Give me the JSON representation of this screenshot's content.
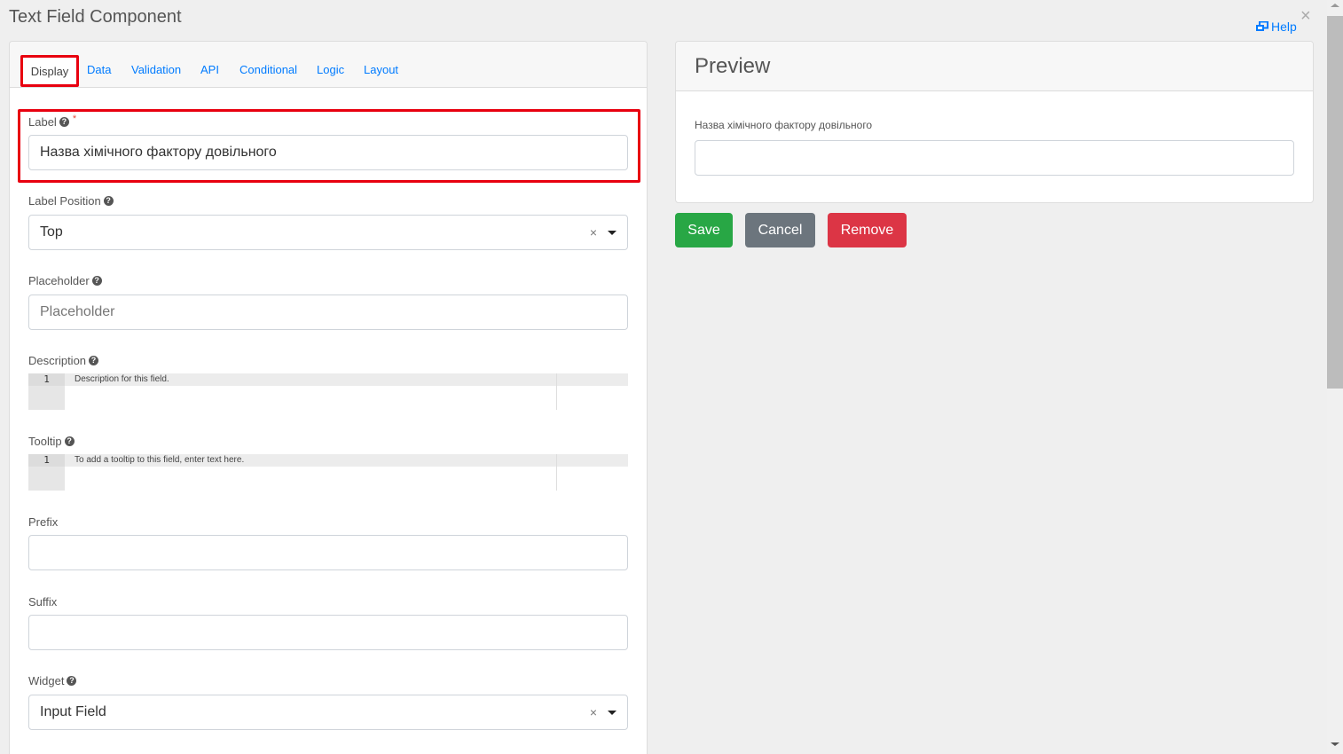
{
  "dialog": {
    "title": "Text Field Component",
    "help_label": "Help",
    "close_symbol": "×"
  },
  "tabs": [
    {
      "label": "Display",
      "active": true
    },
    {
      "label": "Data",
      "active": false
    },
    {
      "label": "Validation",
      "active": false
    },
    {
      "label": "API",
      "active": false
    },
    {
      "label": "Conditional",
      "active": false
    },
    {
      "label": "Logic",
      "active": false
    },
    {
      "label": "Layout",
      "active": false
    }
  ],
  "form": {
    "label": {
      "label": "Label",
      "required_mark": "*",
      "value": "Назва хімічного фактору довільного"
    },
    "label_position": {
      "label": "Label Position",
      "value": "Top",
      "clear_symbol": "×"
    },
    "placeholder": {
      "label": "Placeholder",
      "value": "",
      "placeholder": "Placeholder"
    },
    "description": {
      "label": "Description",
      "line_number": "1",
      "text": "Description for this field."
    },
    "tooltip": {
      "label": "Tooltip",
      "line_number": "1",
      "text": "To add a tooltip to this field, enter text here."
    },
    "prefix": {
      "label": "Prefix",
      "value": ""
    },
    "suffix": {
      "label": "Suffix",
      "value": ""
    },
    "widget": {
      "label": "Widget",
      "value": "Input Field",
      "clear_symbol": "×"
    }
  },
  "preview": {
    "title": "Preview",
    "field_label": "Назва хімічного фактору довільного",
    "field_value": ""
  },
  "buttons": {
    "save": "Save",
    "cancel": "Cancel",
    "remove": "Remove"
  },
  "colors": {
    "accent_link": "#007bff",
    "highlight_red": "#e8000f",
    "save": "#28a745",
    "cancel": "#6c757d",
    "remove": "#dc3545"
  },
  "icons": {
    "help_q": "?"
  }
}
